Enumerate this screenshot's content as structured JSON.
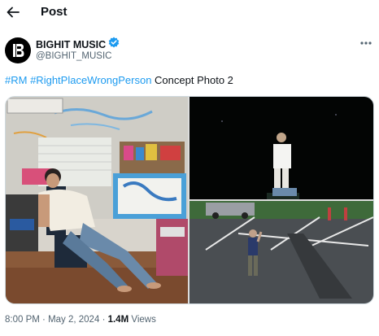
{
  "header": {
    "title": "Post",
    "back_icon": "arrow-left-icon"
  },
  "author": {
    "name": "BIGHIT MUSIC",
    "handle": "@BIGHIT_MUSIC",
    "avatar_icon": "bighit-logo-icon",
    "verified_icon": "verified-badge-icon",
    "verified_color": "#1d9bf0"
  },
  "more_icon": "more-horizontal-icon",
  "tweet": {
    "hashtag1": "#RM",
    "hashtag2": "#RightPlaceWrongPerson",
    "text": "Concept Photo 2",
    "link_color": "#1d9bf0"
  },
  "media": {
    "count": 3,
    "photos": [
      "photo-room-chair",
      "photo-night-standing",
      "photo-parking-lot"
    ]
  },
  "meta": {
    "time": "8:00 PM",
    "date": "May 2, 2024",
    "views_count": "1.4M",
    "views_label": "Views"
  }
}
